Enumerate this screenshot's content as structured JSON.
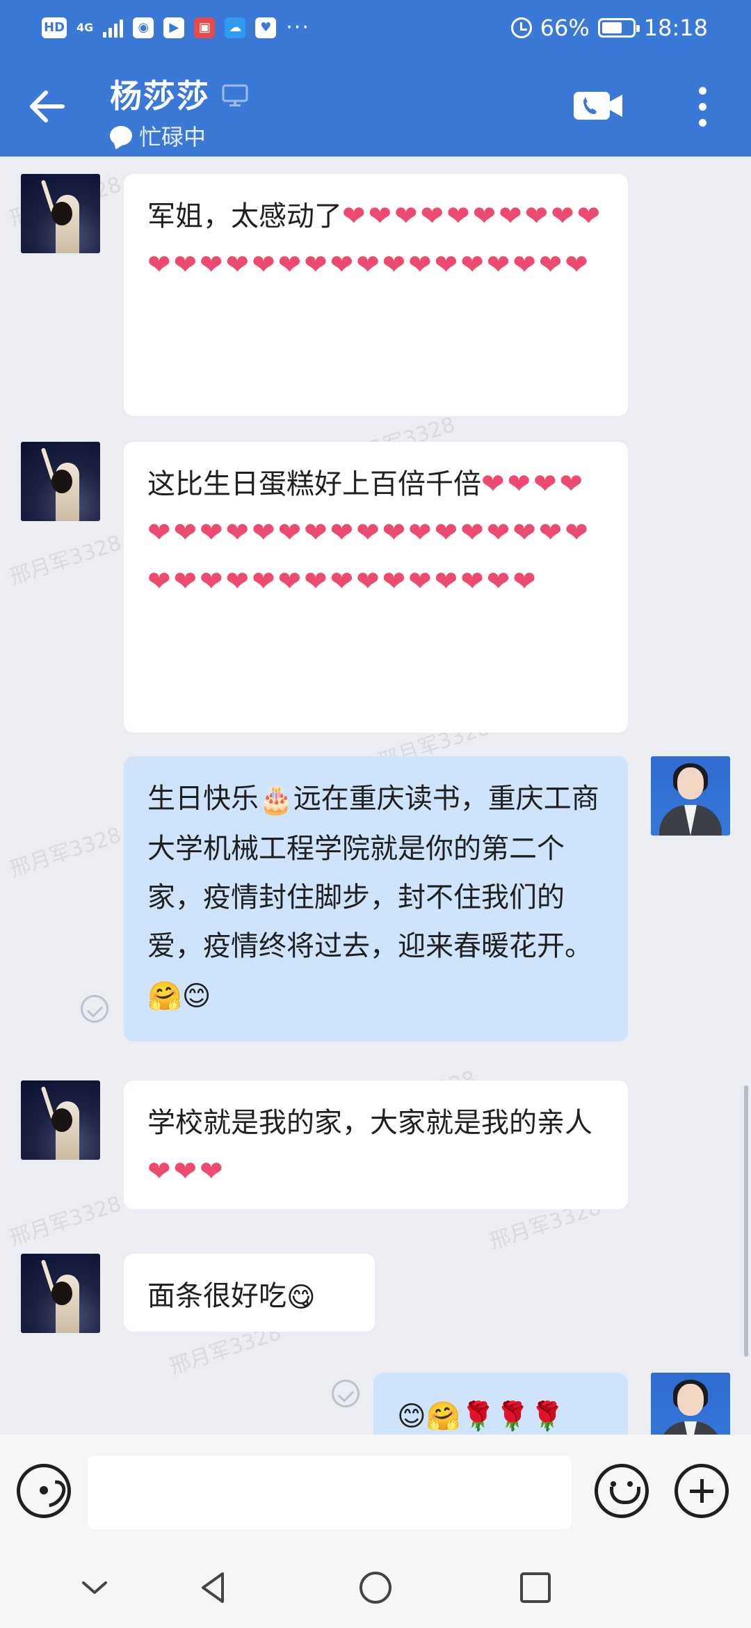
{
  "status_bar": {
    "hd": "HD",
    "network": "4G",
    "battery_text": "66%",
    "battery_level": 0.66,
    "time": "18:18"
  },
  "header": {
    "name": "杨莎莎",
    "status": "忙碌中"
  },
  "watermark": "邢月军3328",
  "messages": [
    {
      "side": "in",
      "text": "军姐，太感动了",
      "hearts": "❤❤❤❤❤❤❤❤❤❤❤❤❤❤❤❤❤❤❤❤❤❤❤❤❤❤❤"
    },
    {
      "side": "in",
      "text": "这比生日蛋糕好上百倍千倍",
      "hearts": "❤❤❤❤❤❤❤❤❤❤❤❤❤❤❤❤❤❤❤❤❤❤❤❤❤❤❤❤❤❤❤❤❤❤❤❤"
    },
    {
      "side": "out",
      "text_a": "生日快乐",
      "emoji_a": "🎂",
      "text_b": "远在重庆读书，重庆工商大学机械工程学院就是你的第二个家，疫情封住脚步，封不住我们的爱，疫情终将过去，迎来春暖花开。",
      "emoji_b": "🤗😊"
    },
    {
      "side": "in",
      "text": "学校就是我的家，大家就是我的亲人",
      "hearts": "❤❤❤"
    },
    {
      "side": "in",
      "text": "面条很好吃",
      "emoji": "😋"
    },
    {
      "side": "out",
      "emoji": "😊🤗🌹🌹🌹"
    }
  ],
  "input": {
    "placeholder": ""
  },
  "colors": {
    "header": "#3b79d6",
    "bubble_out": "#cfe4fb",
    "bubble_in": "#ffffff",
    "heart": "#ec4a6e"
  },
  "icons": [
    "back-arrow-icon",
    "computer-icon",
    "speech-bubble-icon",
    "video-call-icon",
    "more-icon",
    "voice-icon",
    "emoji-icon",
    "plus-icon",
    "read-check-icon"
  ]
}
